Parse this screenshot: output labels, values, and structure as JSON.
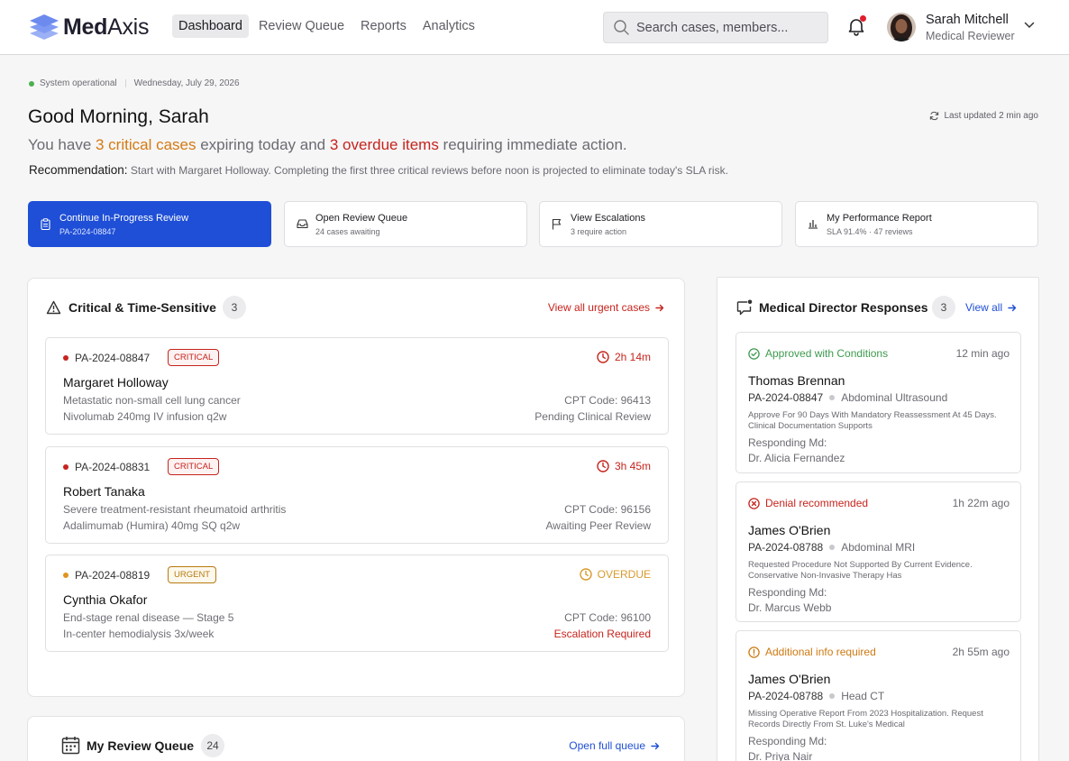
{
  "header": {
    "logo_bold": "Med",
    "logo_rest": "Axis",
    "nav": [
      {
        "label": "Dashboard"
      },
      {
        "label": "Review Queue"
      },
      {
        "label": "Reports"
      },
      {
        "label": "Analytics"
      }
    ],
    "search_placeholder": "Search cases, members...",
    "user_name": "Sarah Mitchell",
    "user_role": "Medical Reviewer"
  },
  "intro": {
    "system_status": "System operational",
    "date": "Wednesday, July 29, 2026",
    "greeting": "Good Morning, Sarah",
    "last_updated": "Last updated 2 min ago",
    "summary_pre": "You have ",
    "summary_critical": "3 critical cases",
    "summary_mid": " expiring today and ",
    "summary_overdue": "3 overdue items",
    "summary_post": " requiring immediate action.",
    "recommend_label": "Recommendation:",
    "recommend_text": " Start with Margaret Holloway. Completing the first three critical reviews before noon is projected to eliminate today's SLA risk."
  },
  "actions": [
    {
      "title": "Continue In-Progress Review",
      "sub": "PA-2024-08847",
      "icon": "clipboard-icon"
    },
    {
      "title": "Open Review Queue",
      "sub": "24 cases awaiting",
      "icon": "inbox-icon"
    },
    {
      "title": "View Escalations",
      "sub": "3 require action",
      "icon": "flag-icon"
    },
    {
      "title": "My Performance Report",
      "sub": "SLA 91.4% · 47 reviews",
      "icon": "bar-chart-icon"
    }
  ],
  "critical": {
    "title": "Critical & Time-Sensitive",
    "count": "3",
    "link": "View all urgent cases",
    "cases": [
      {
        "id": "PA-2024-08847",
        "badge": "CRITICAL",
        "time": "2h 14m",
        "name": "Margaret Holloway",
        "diagnosis": "Metastatic non-small cell lung cancer",
        "treatment": "Nivolumab 240mg IV infusion q2w",
        "cpt": "CPT Code: 96413",
        "status": "Pending Clinical Review"
      },
      {
        "id": "PA-2024-08831",
        "badge": "CRITICAL",
        "time": "3h 45m",
        "name": "Robert Tanaka",
        "diagnosis": "Severe treatment-resistant rheumatoid arthritis",
        "treatment": "Adalimumab (Humira) 40mg SQ q2w",
        "cpt": "CPT Code: 96156",
        "status": "Awaiting Peer Review"
      },
      {
        "id": "PA-2024-08819",
        "badge": "URGENT",
        "time": "OVERDUE",
        "name": "Cynthia Okafor",
        "diagnosis": "End-stage renal disease — Stage 5",
        "treatment": "In-center hemodialysis 3x/week",
        "cpt": "CPT Code: 96100",
        "status": "Escalation Required"
      }
    ]
  },
  "queue": {
    "title": "My Review Queue",
    "count": "24",
    "link": "Open full queue"
  },
  "responses": {
    "title": "Medical Director Responses",
    "count": "3",
    "link": "View all",
    "items": [
      {
        "status": "Approved with Conditions",
        "ago": "12 min ago",
        "name": "Thomas Brennan",
        "case_id": "PA-2024-08847",
        "procedure": "Abdominal Ultrasound",
        "note": "Approve For 90 Days With Mandatory Reassessment At 45 Days. Clinical Documentation Supports",
        "label": "Responding Md:",
        "md": "Dr. Alicia Fernandez"
      },
      {
        "status": "Denial recommended",
        "ago": "1h 22m ago",
        "name": "James O'Brien",
        "case_id": "PA-2024-08788",
        "procedure": "Abdominal MRI",
        "note": "Requested Procedure Not Supported By Current Evidence. Conservative Non-Invasive Therapy Has",
        "label": "Responding Md:",
        "md": "Dr. Marcus Webb"
      },
      {
        "status": "Additional info required",
        "ago": "2h 55m ago",
        "name": "James O'Brien",
        "case_id": "PA-2024-08788",
        "procedure": "Head CT",
        "note": "Missing Operative Report From 2023 Hospitalization. Request Records Directly From St. Luke's Medical",
        "label": "Responding Md:",
        "md": "Dr. Priya Nair"
      }
    ]
  },
  "colors": {
    "primary": "#1f4fd6",
    "critical": "#c6241d",
    "warning": "#d89a2b",
    "success": "#3e9b4f"
  }
}
